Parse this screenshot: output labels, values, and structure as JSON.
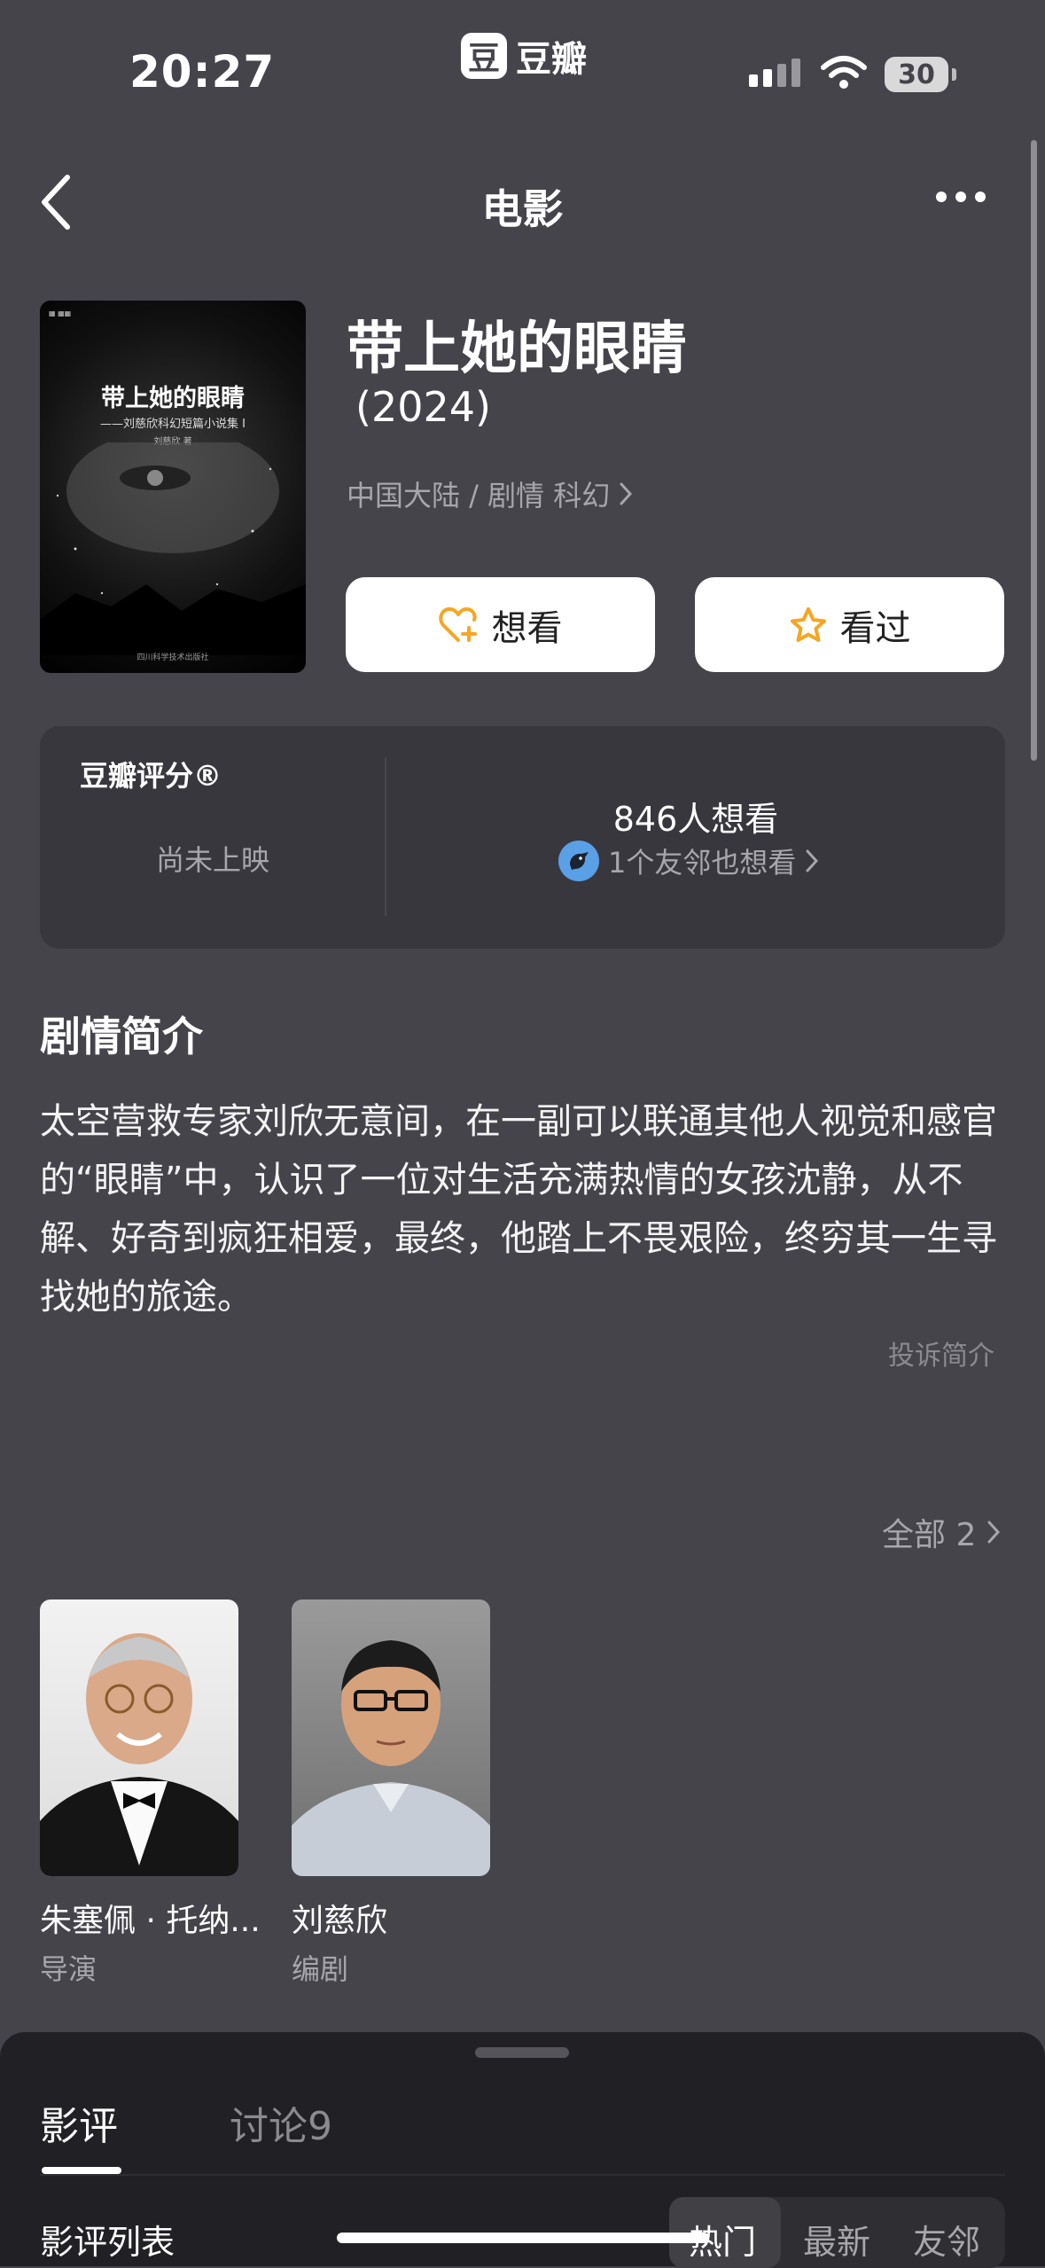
{
  "status_bar": {
    "time": "20:27",
    "app_logo_char": "豆",
    "app_name": "豆瓣",
    "battery": "30",
    "icons": [
      "signal-icon",
      "wifi-icon",
      "battery-icon"
    ]
  },
  "nav": {
    "title": "电影",
    "back_icon": "chevron-left-icon",
    "more_icon": "more-dots-icon"
  },
  "poster": {
    "title": "带上她的眼睛",
    "subtitle": "——刘慈欣科幻短篇小说集 I",
    "author": "刘慈欣 著",
    "publisher": "四川科学技术出版社"
  },
  "movie": {
    "title": "带上她的眼睛",
    "year": "(2024)",
    "meta": "中国大陆 / 剧情 科幻",
    "wish_label": "想看",
    "seen_label": "看过",
    "accent_color": "#f5a623"
  },
  "rating": {
    "label": "豆瓣评分®",
    "status": "尚未上映",
    "wish_count": "846人想看",
    "friends": "1个友邻也想看"
  },
  "synopsis": {
    "heading": "剧情简介",
    "body": "太空营救专家刘欣无意间，在一副可以联通其他人视觉和感官的“眼睛”中，认识了一位对生活充满热情的女孩沈静，从不解、好奇到疯狂相爱，最终，他踏上不畏艰险，终穷其一生寻找她的旅途。",
    "report": "投诉简介"
  },
  "crew": {
    "all_label": "全部 2",
    "members": [
      {
        "name": "朱塞佩 · 托纳...",
        "role": "导演"
      },
      {
        "name": "刘慈欣",
        "role": "编剧"
      }
    ]
  },
  "sheet": {
    "tab_reviews": "影评",
    "tab_discussion": "讨论9",
    "list_label": "影评列表",
    "sort_options": [
      "热门",
      "最新",
      "友邻"
    ],
    "selected_sort": "热门"
  }
}
